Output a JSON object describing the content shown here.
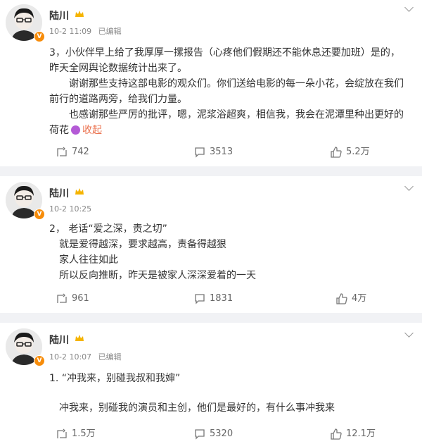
{
  "posts": [
    {
      "author": "陆川",
      "time": "10-2 11:09",
      "edited": "已编辑",
      "paragraphs": [
        "3，小伙伴早上给了我厚厚一摞报告（心疼他们假期还不能休息还要加班）是的，昨天全网舆论数据统计出来了。",
        "谢谢那些支持这部电影的观众们。你们送给电影的每一朵小花，会绽放在我们前行的道路两旁，给我们力量。",
        "也感谢那些严厉的批评，嗯，泥浆浴超爽，相信我，我会在泥潭里种出更好的荷花"
      ],
      "collapse": "收起",
      "reposts": "742",
      "comments": "3513",
      "likes": "5.2万"
    },
    {
      "author": "陆川",
      "time": "10-2 10:25",
      "lines": [
        "2，  老话“爱之深，责之切”",
        "就是爱得越深，要求越高，责备得越狠",
        "家人往往如此",
        "所以反向推断，昨天是被家人深深爱着的一天"
      ],
      "reposts": "961",
      "comments": "1831",
      "likes": "4万"
    },
    {
      "author": "陆川",
      "time": "10-2 10:07",
      "edited": "已编辑",
      "lines": [
        "1. “冲我来，别碰我叔和我婶”",
        "冲我来，别碰我的演员和主创，他们是最好的，有什么事冲我来"
      ],
      "reposts": "1.5万",
      "comments": "5320",
      "likes": "12.1万"
    }
  ],
  "icons": {
    "repost": "repost-icon",
    "comment": "comment-icon",
    "like": "thumbs-up-icon",
    "crown": "crown-icon",
    "verified": "verified-v-icon",
    "menu": "chevron-down-icon"
  },
  "colors": {
    "separator": "#f1f2f5",
    "meta": "#888888",
    "collapse_link": "#eb7350",
    "verified_badge": "#f78c0a"
  }
}
